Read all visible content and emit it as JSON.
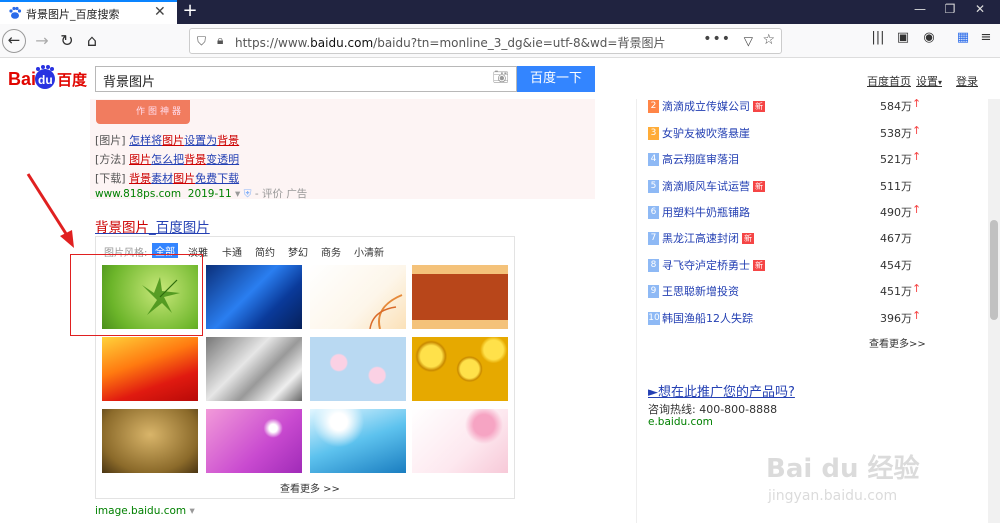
{
  "browser": {
    "tab_title": "背景图片_百度搜索",
    "new_tab": "+",
    "url_plain": "https://www.",
    "url_domain": "baidu.com",
    "url_rest": "/baidu?tn=monline_3_dg&ie=utf-8&wd=背景图片"
  },
  "header": {
    "query": "背景图片",
    "search_button": "百度一下",
    "links": [
      "百度首页",
      "设置",
      "登录"
    ],
    "settings_caret": "▾"
  },
  "ad": {
    "banner_text": "作图神器",
    "lines": [
      {
        "tag": "[图片]",
        "parts": [
          "怎样将",
          "图片",
          "设置为",
          "背景"
        ]
      },
      {
        "tag": "[方法]",
        "parts": [
          "图片",
          "怎么把",
          "背景",
          "变透明"
        ]
      },
      {
        "tag": "[下载]",
        "parts": [
          "背景",
          "素材",
          "图片",
          "免费下载"
        ]
      }
    ],
    "site": "www.818ps.com",
    "date": "2019-11",
    "rating": "- 评价",
    "ad_label": "广告"
  },
  "image_result": {
    "title_a": "背景图片",
    "title_b": "_百度图片",
    "style_label": "图片风格:",
    "styles": [
      "全部",
      "淡雅",
      "卡通",
      "简约",
      "梦幻",
      "商务",
      "小清新"
    ],
    "more": "查看更多 >>",
    "site": "image.baidu.com"
  },
  "hotlist": [
    {
      "rank": "2",
      "title": "滴滴成立传媒公司",
      "new": "新",
      "value": "584万",
      "up": true
    },
    {
      "rank": "3",
      "title": "女驴友被吹落悬崖",
      "new": "",
      "value": "538万",
      "up": true
    },
    {
      "rank": "4",
      "title": "高云翔庭审落泪",
      "new": "",
      "value": "521万",
      "up": true
    },
    {
      "rank": "5",
      "title": "滴滴顺风车试运营",
      "new": "新",
      "value": "511万",
      "up": false
    },
    {
      "rank": "6",
      "title": "用塑料牛奶瓶铺路",
      "new": "",
      "value": "490万",
      "up": true
    },
    {
      "rank": "7",
      "title": "黑龙江高速封闭",
      "new": "新",
      "value": "467万",
      "up": false
    },
    {
      "rank": "8",
      "title": "寻飞夺泸定桥勇士",
      "new": "新",
      "value": "454万",
      "up": false
    },
    {
      "rank": "9",
      "title": "王思聪新增投资",
      "new": "",
      "value": "451万",
      "up": true
    },
    {
      "rank": "10",
      "title": "韩国渔船12人失踪",
      "new": "",
      "value": "396万",
      "up": true
    }
  ],
  "hot_more": "查看更多>>",
  "promo": {
    "title": "►想在此推广您的产品吗?",
    "hotline": "咨询热线: 400-800-8888",
    "url": "e.baidu.com"
  },
  "watermark": {
    "main": "Bai du 经验",
    "sub": "jingyan.baidu.com"
  },
  "colors": {
    "accent": "#3385ff",
    "link": "#2440b3",
    "highlight": "#c00000",
    "green": "#008000",
    "annotation": "#e02020"
  }
}
